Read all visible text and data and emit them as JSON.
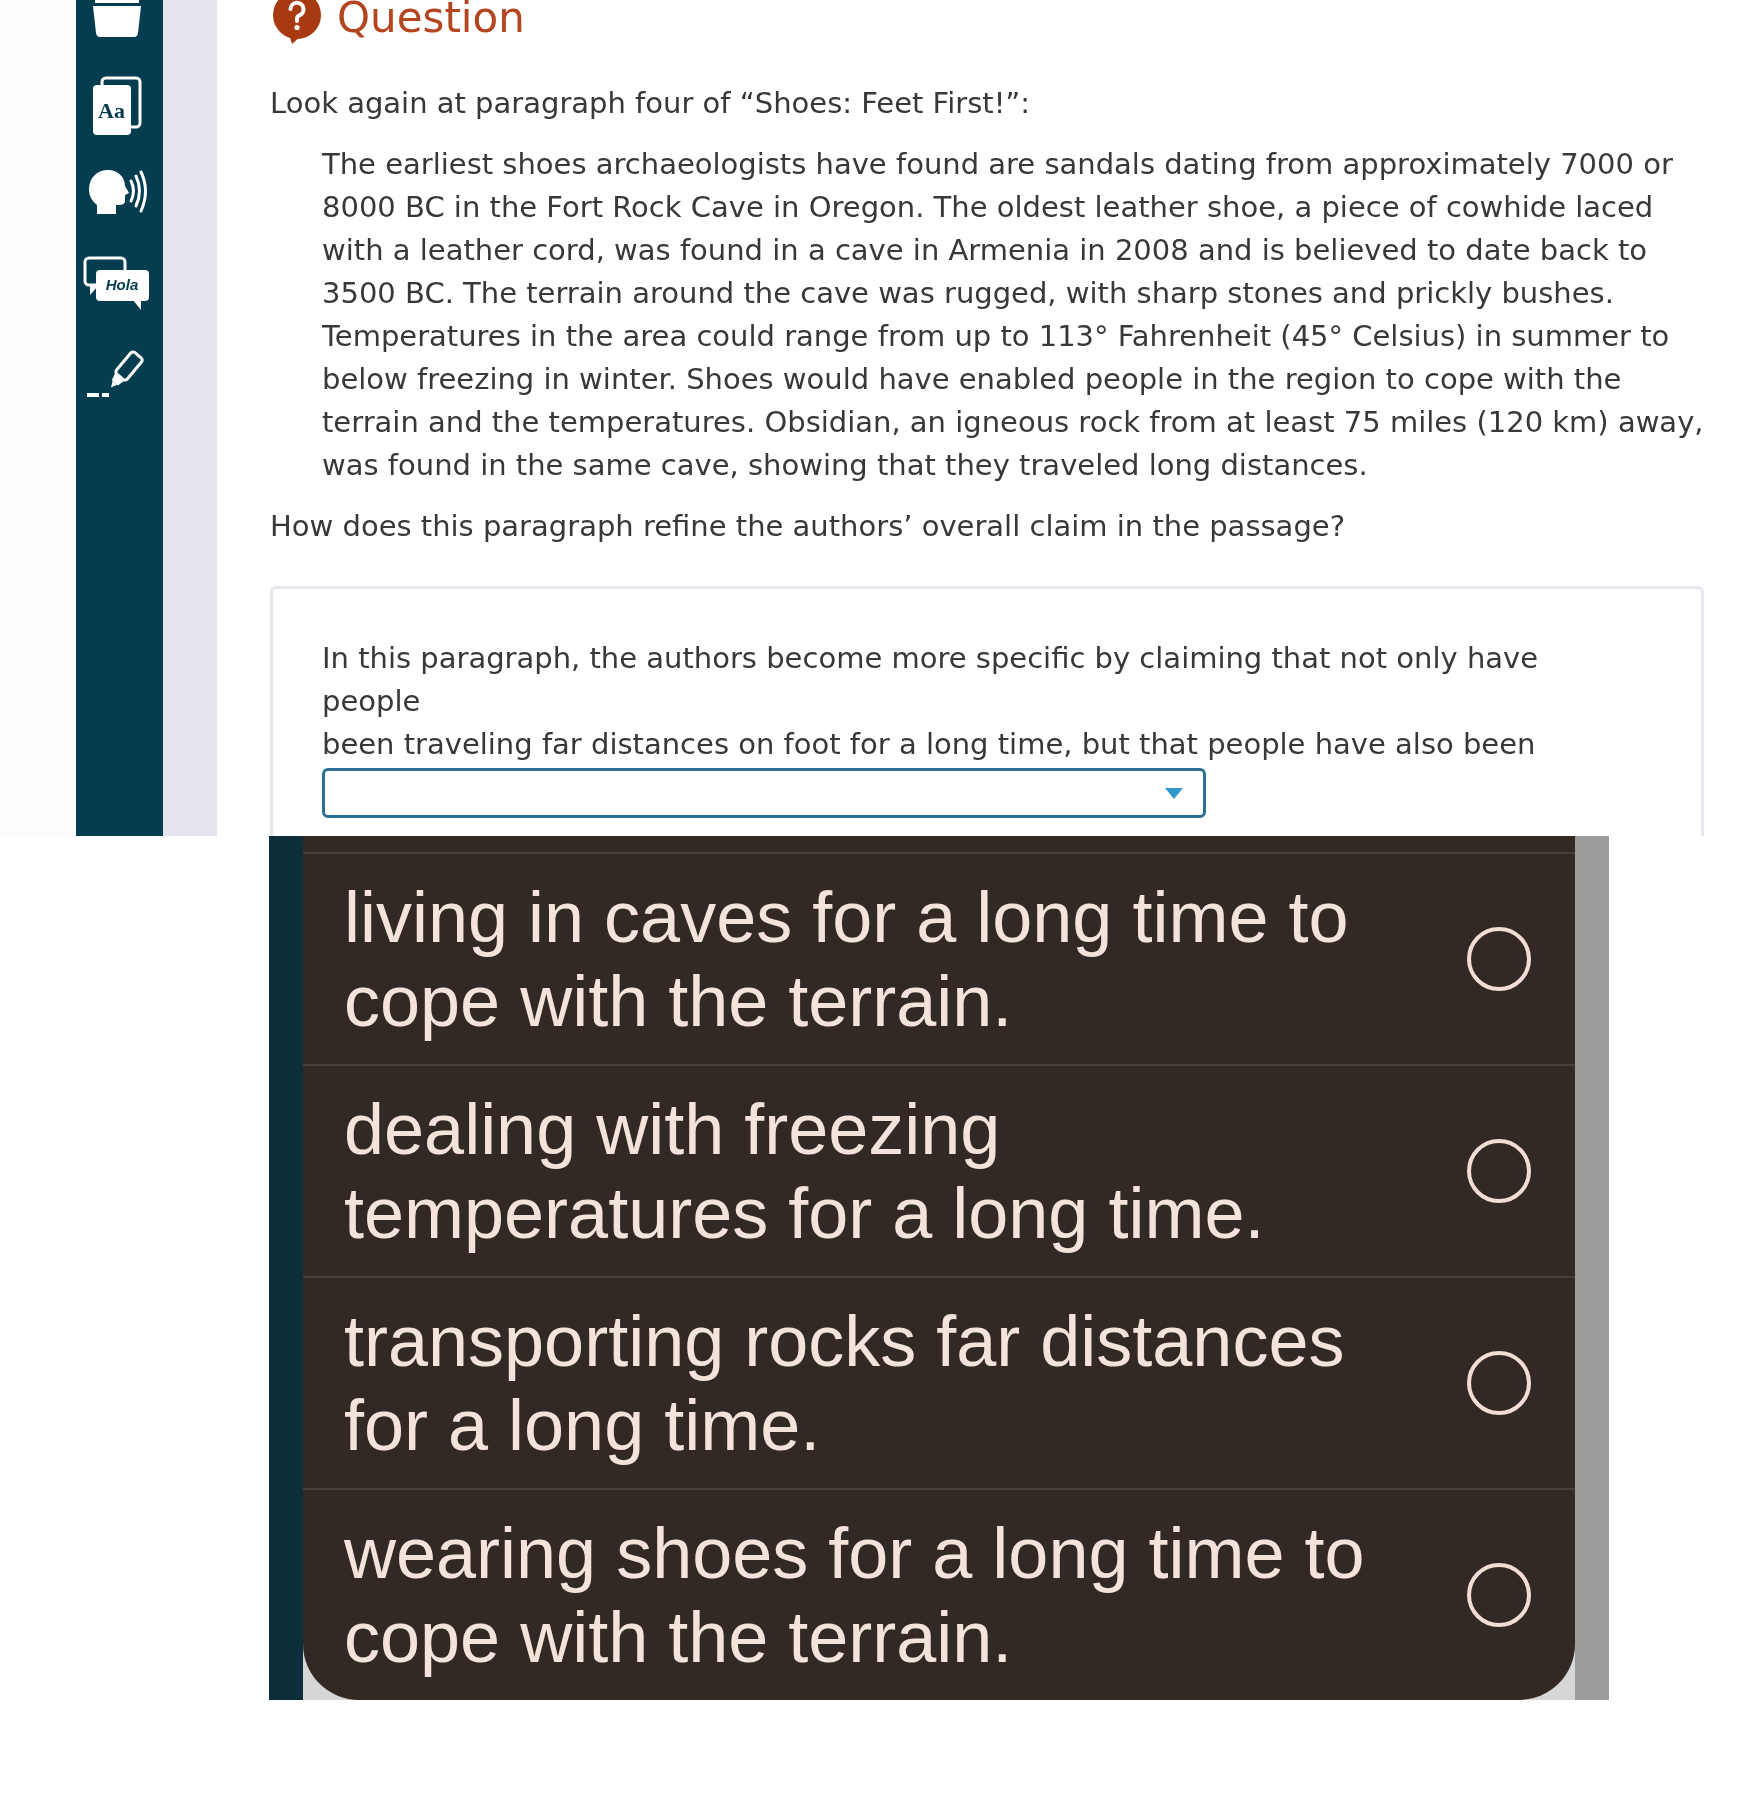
{
  "sidebar": {
    "tools": [
      {
        "kind": "tray"
      },
      {
        "kind": "glossary",
        "label": "Aa"
      },
      {
        "kind": "read_aloud"
      },
      {
        "kind": "translate",
        "label": "Hola"
      },
      {
        "kind": "highlighter"
      }
    ]
  },
  "question": {
    "heading": "Question",
    "prompt": "Look again at paragraph four of “Shoes: Feet First!”:",
    "excerpt": "The earliest shoes archaeologists have found are sandals dating from approximately 7000 or 8000 BC in the Fort Rock Cave in Oregon. The oldest leather shoe, a piece of cowhide laced with a leather cord, was found in a cave in Armenia in 2008 and is believed to date back to 3500 BC. The terrain around the cave was rugged, with sharp stones and prickly bushes. Temperatures in the area could range from up to 113° Fahrenheit (45° Celsius) in summer to below freezing in winter. Shoes would have enabled people in the region to cope with the terrain and the temperatures. Obsidian, an igneous rock from at least 75 miles (120 km) away, was found in the same cave, showing that they traveled long distances.",
    "text": "How does this paragraph refine the authors’ overall claim in the passage?"
  },
  "answer": {
    "sentence_parts": [
      "In this paragraph, the authors become more specific by claiming that not only have people",
      "been traveling far distances on foot for a long time, but that people have also been"
    ],
    "dropdown": {
      "expanded": true
    }
  },
  "options": [
    {
      "label": "living in caves for a long time to cope with the terrain.",
      "selected": false
    },
    {
      "label": "dealing with freezing temperatures for a long time.",
      "selected": false
    },
    {
      "label": "transporting rocks far distances for a long time.",
      "selected": false
    },
    {
      "label": "wearing shoes for a long time to cope with the terrain.",
      "selected": false
    }
  ]
}
